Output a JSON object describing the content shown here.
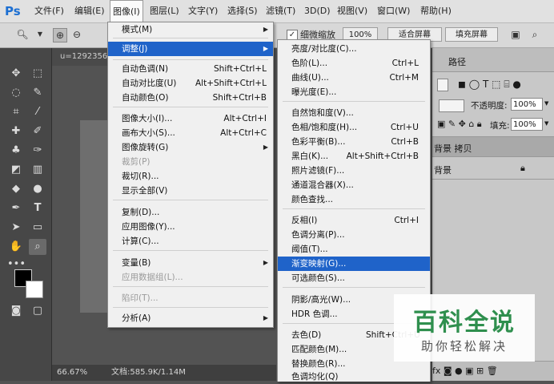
{
  "app": {
    "logo": "Ps"
  },
  "menubar": {
    "items": [
      "文件(F)",
      "编辑(E)",
      "图像(I)",
      "图层(L)",
      "文字(Y)",
      "选择(S)",
      "滤镜(T)",
      "3D(D)",
      "视图(V)",
      "窗口(W)",
      "帮助(H)"
    ]
  },
  "options": {
    "checkbox_label": "细微缩放",
    "zoom_btn": "100%",
    "fit_btn": "适合屏幕",
    "fill_btn": "填充屏幕"
  },
  "document": {
    "tab_label": "u=1292356",
    "zoom": "66.67%",
    "doc_size": "文档:585.9K/1.14M"
  },
  "panels": {
    "paths_tab": "路径",
    "opacity_label": "不透明度:",
    "opacity_value": "100%",
    "fill_label": "填充:",
    "fill_value": "100%",
    "layers": [
      "背景 拷贝",
      "背景"
    ]
  },
  "image_menu": {
    "items": [
      {
        "label": "模式(M)",
        "shortcut": "",
        "submenu": true
      },
      {
        "label": "调整(J)",
        "shortcut": "",
        "submenu": true,
        "highlighted": true
      },
      {
        "label": "自动色调(N)",
        "shortcut": "Shift+Ctrl+L"
      },
      {
        "label": "自动对比度(U)",
        "shortcut": "Alt+Shift+Ctrl+L"
      },
      {
        "label": "自动颜色(O)",
        "shortcut": "Shift+Ctrl+B"
      },
      {
        "label": "图像大小(I)...",
        "shortcut": "Alt+Ctrl+I"
      },
      {
        "label": "画布大小(S)...",
        "shortcut": "Alt+Ctrl+C"
      },
      {
        "label": "图像旋转(G)",
        "shortcut": "",
        "submenu": true
      },
      {
        "label": "裁剪(P)",
        "shortcut": "",
        "disabled": true
      },
      {
        "label": "裁切(R)...",
        "shortcut": ""
      },
      {
        "label": "显示全部(V)",
        "shortcut": ""
      },
      {
        "label": "复制(D)...",
        "shortcut": ""
      },
      {
        "label": "应用图像(Y)...",
        "shortcut": ""
      },
      {
        "label": "计算(C)...",
        "shortcut": ""
      },
      {
        "label": "变量(B)",
        "shortcut": "",
        "submenu": true
      },
      {
        "label": "应用数据组(L)...",
        "shortcut": "",
        "disabled": true
      },
      {
        "label": "陷印(T)...",
        "shortcut": "",
        "disabled": true
      },
      {
        "label": "分析(A)",
        "shortcut": "",
        "submenu": true
      }
    ]
  },
  "adjust_menu": {
    "items": [
      {
        "label": "亮度/对比度(C)...",
        "shortcut": ""
      },
      {
        "label": "色阶(L)...",
        "shortcut": "Ctrl+L"
      },
      {
        "label": "曲线(U)...",
        "shortcut": "Ctrl+M"
      },
      {
        "label": "曝光度(E)...",
        "shortcut": ""
      },
      {
        "label": "自然饱和度(V)...",
        "shortcut": ""
      },
      {
        "label": "色相/饱和度(H)...",
        "shortcut": "Ctrl+U"
      },
      {
        "label": "色彩平衡(B)...",
        "shortcut": "Ctrl+B"
      },
      {
        "label": "黑白(K)...",
        "shortcut": "Alt+Shift+Ctrl+B"
      },
      {
        "label": "照片滤镜(F)...",
        "shortcut": ""
      },
      {
        "label": "通道混合器(X)...",
        "shortcut": ""
      },
      {
        "label": "颜色查找...",
        "shortcut": ""
      },
      {
        "label": "反相(I)",
        "shortcut": "Ctrl+I"
      },
      {
        "label": "色调分离(P)...",
        "shortcut": ""
      },
      {
        "label": "阈值(T)...",
        "shortcut": ""
      },
      {
        "label": "渐变映射(G)...",
        "shortcut": "",
        "highlighted": true
      },
      {
        "label": "可选颜色(S)...",
        "shortcut": ""
      },
      {
        "label": "阴影/高光(W)...",
        "shortcut": ""
      },
      {
        "label": "HDR 色调...",
        "shortcut": ""
      },
      {
        "label": "去色(D)",
        "shortcut": "Shift+Ctrl+U"
      },
      {
        "label": "匹配颜色(M)...",
        "shortcut": ""
      },
      {
        "label": "替换颜色(R)...",
        "shortcut": ""
      },
      {
        "label": "色调均化(Q)",
        "shortcut": ""
      }
    ]
  },
  "watermark": {
    "title": "百科全说",
    "subtitle": "助你轻松解决"
  }
}
